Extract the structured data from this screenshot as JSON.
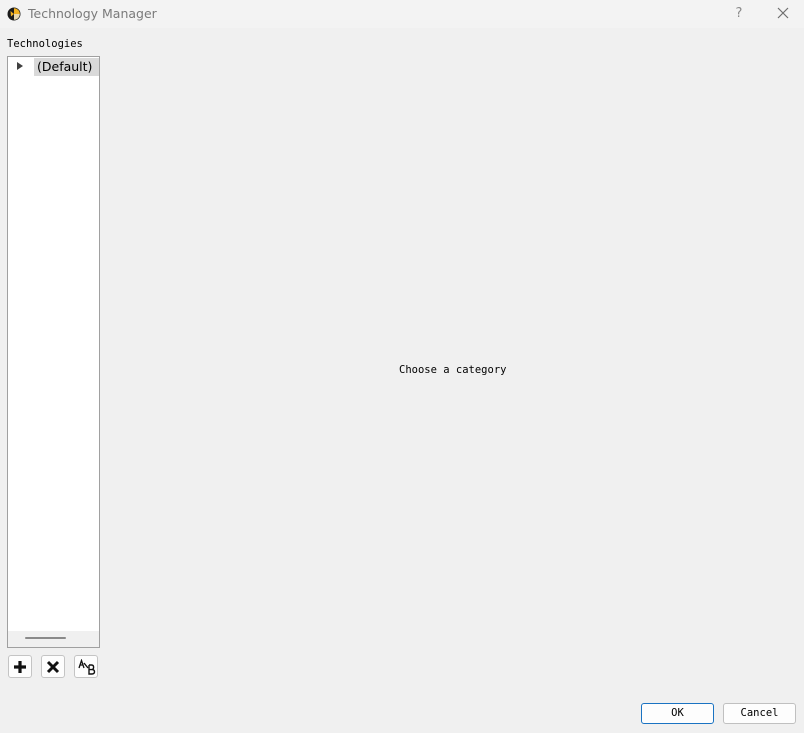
{
  "window": {
    "title": "Technology Manager",
    "help_label": "?"
  },
  "technologies": {
    "label": "Technologies",
    "items": [
      {
        "label": "(Default)",
        "selected": true,
        "expanded": false
      }
    ]
  },
  "toolbar": {
    "add_icon": "plus-icon",
    "delete_icon": "x-icon",
    "rename_icon": "ab-rename-icon"
  },
  "main": {
    "placeholder": "Choose a category"
  },
  "buttons": {
    "ok_label": "OK",
    "cancel_label": "Cancel"
  },
  "colors": {
    "accent": "#1a73c2",
    "selection": "#d9d9d9",
    "background": "#f0f0f0"
  }
}
